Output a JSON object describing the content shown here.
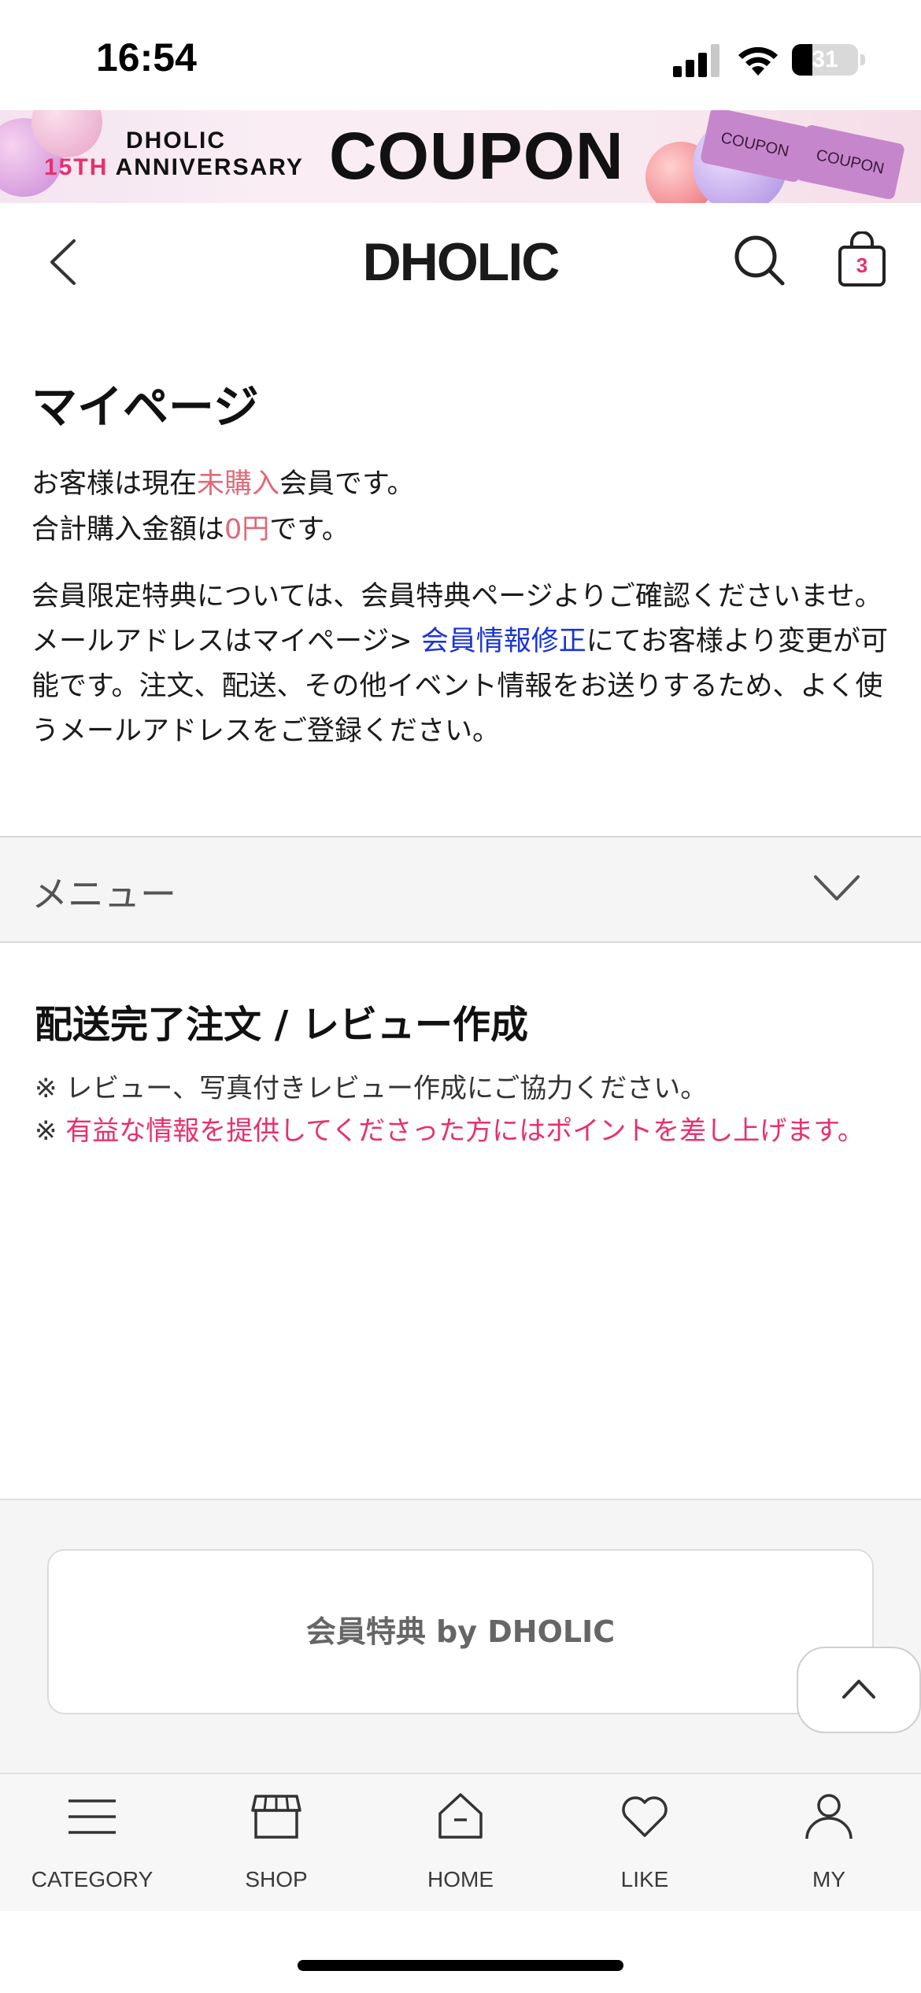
{
  "status_bar": {
    "time": "16:54",
    "battery": "31",
    "battery_level": 0.31
  },
  "banner": {
    "line1": "DHOLIC",
    "line2_highlight": "15TH",
    "line2_rest": " ANNIVERSARY",
    "title": "COUPON",
    "ticket_label": "COUPON"
  },
  "header": {
    "logo": "DHOLIC",
    "cart_count": "3"
  },
  "mypage": {
    "title": "マイページ",
    "status_prefix": "お客様は現在",
    "status_value": "未購入",
    "status_suffix": "会員です。",
    "total_prefix": "合計購入金額は",
    "total_value": "0円",
    "total_suffix": "です。",
    "notice_1": "会員限定特典については、会員特典ページよりご確認くださいませ。",
    "notice_2_prefix": "メールアドレスはマイページ> ",
    "notice_2_link": "会員情報修正",
    "notice_2_suffix": "にてお客様より変更が可能です。注文、配送、その他イベント情報をお送りするため、よく使うメールアドレスをご登録ください。"
  },
  "menu": {
    "label": "メニュー"
  },
  "review": {
    "title": "配送完了注文 / レビュー作成",
    "note_1": "※ レビュー、写真付きレビュー作成にご協力ください。",
    "note_2_mark": "※ ",
    "note_2_text": "有益な情報を提供してくださった方にはポイントを差し上げます。"
  },
  "footer": {
    "benefit_label": "会員特典 by DHOLIC"
  },
  "bottom_nav": [
    {
      "label": "CATEGORY",
      "icon": "menu-icon"
    },
    {
      "label": "SHOP",
      "icon": "shop-icon"
    },
    {
      "label": "HOME",
      "icon": "home-icon"
    },
    {
      "label": "LIKE",
      "icon": "heart-icon"
    },
    {
      "label": "MY",
      "icon": "person-icon"
    }
  ],
  "colors": {
    "accent_pink": "#e8306e",
    "status_red": "#e06a78",
    "link_blue": "#1a34d6"
  }
}
